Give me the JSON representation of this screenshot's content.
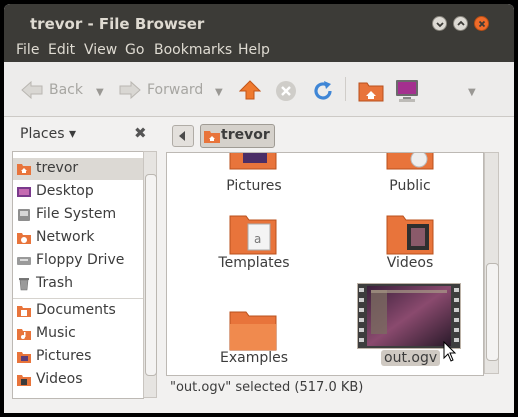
{
  "window": {
    "title": "trevor - File Browser"
  },
  "menubar": [
    "File",
    "Edit",
    "View",
    "Go",
    "Bookmarks",
    "Help"
  ],
  "toolbar": {
    "back_label": "Back",
    "forward_label": "Forward"
  },
  "sidebar": {
    "header": "Places",
    "items": [
      {
        "label": "trevor",
        "icon": "home-folder-icon",
        "selected": true
      },
      {
        "label": "Desktop",
        "icon": "desktop-icon"
      },
      {
        "label": "File System",
        "icon": "hard-drive-icon"
      },
      {
        "label": "Network",
        "icon": "network-icon"
      },
      {
        "label": "Floppy Drive",
        "icon": "floppy-drive-icon"
      },
      {
        "label": "Trash",
        "icon": "trash-icon"
      },
      {
        "label": "Documents",
        "icon": "documents-folder-icon"
      },
      {
        "label": "Music",
        "icon": "music-folder-icon"
      },
      {
        "label": "Pictures",
        "icon": "pictures-folder-icon"
      },
      {
        "label": "Videos",
        "icon": "videos-folder-icon"
      }
    ]
  },
  "pathbar": {
    "current": "trevor"
  },
  "files": [
    {
      "name": "Pictures",
      "icon": "pictures-folder-icon"
    },
    {
      "name": "Public",
      "icon": "public-folder-icon"
    },
    {
      "name": "Templates",
      "icon": "templates-folder-icon"
    },
    {
      "name": "Videos",
      "icon": "videos-folder-icon"
    },
    {
      "name": "Examples",
      "icon": "folder-icon"
    },
    {
      "name": "out.ogv",
      "icon": "video-thumbnail-icon",
      "selected": true
    }
  ],
  "status": "\"out.ogv\" selected (517.0 KB)",
  "colors": {
    "folder": "#e8743b",
    "selection": "#cfc9c2",
    "titlebar": "#3c3b37"
  }
}
